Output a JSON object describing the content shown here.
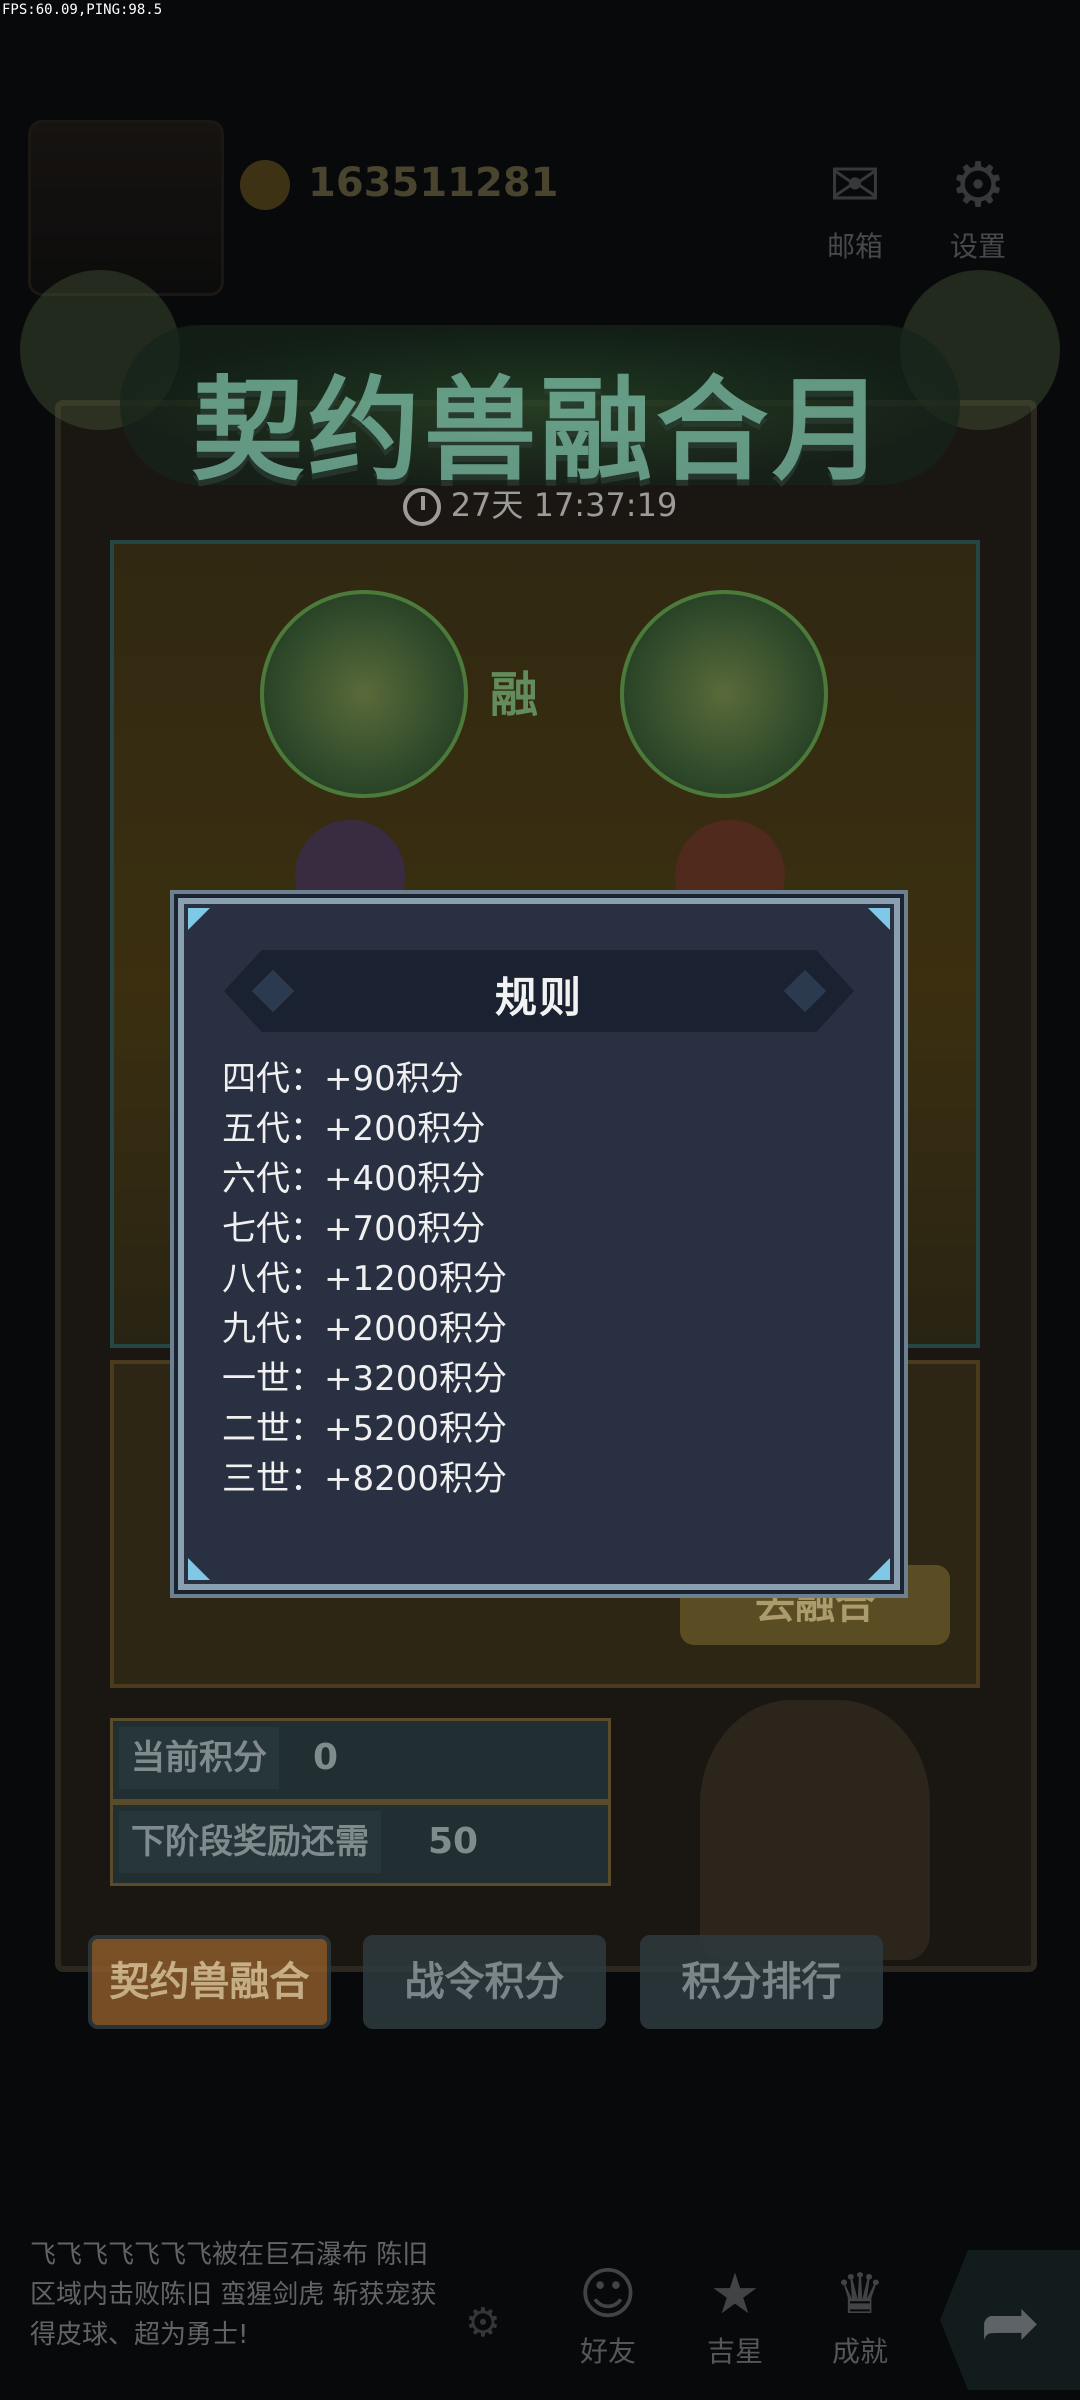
{
  "debug": {
    "fps_ping": "FPS:60.09,PING:98.5"
  },
  "hud": {
    "coins": "163511281",
    "mail_label": "邮箱",
    "settings_label": "设置"
  },
  "event": {
    "title": "契约兽融合月",
    "timer": "27天 17:37:19",
    "fusion_label": "融",
    "go_fusion_label": "去融合",
    "current_score_label": "当前积分",
    "current_score_value": "0",
    "next_stage_label": "下阶段奖励还需",
    "next_stage_value": "50",
    "tabs": [
      {
        "label": "契约兽融合",
        "active": true
      },
      {
        "label": "战令积分",
        "active": false
      },
      {
        "label": "积分排行",
        "active": false
      }
    ]
  },
  "bottom": {
    "chat_text": "飞飞飞飞飞飞飞被在巨石瀑布 陈旧区域内击败陈旧 蛮猩剑虎 斩获宠获得皮球、超为勇士!",
    "nav": [
      {
        "label": "好友",
        "icon": "friends-icon"
      },
      {
        "label": "吉星",
        "icon": "gift-icon"
      },
      {
        "label": "成就",
        "icon": "achievement-icon"
      }
    ]
  },
  "rules_modal": {
    "title": "规则",
    "items": [
      "四代：+90积分",
      "五代：+200积分",
      "六代：+400积分",
      "七代：+700积分",
      "八代：+1200积分",
      "九代：+2000积分",
      "一世：+3200积分",
      "二世：+5200积分",
      "三世：+8200积分"
    ]
  },
  "colors": {
    "modal_bg": "#283042",
    "modal_border": "#8aa0b0",
    "corner_accent": "#7fc8e6",
    "text": "#f0f0f0"
  }
}
